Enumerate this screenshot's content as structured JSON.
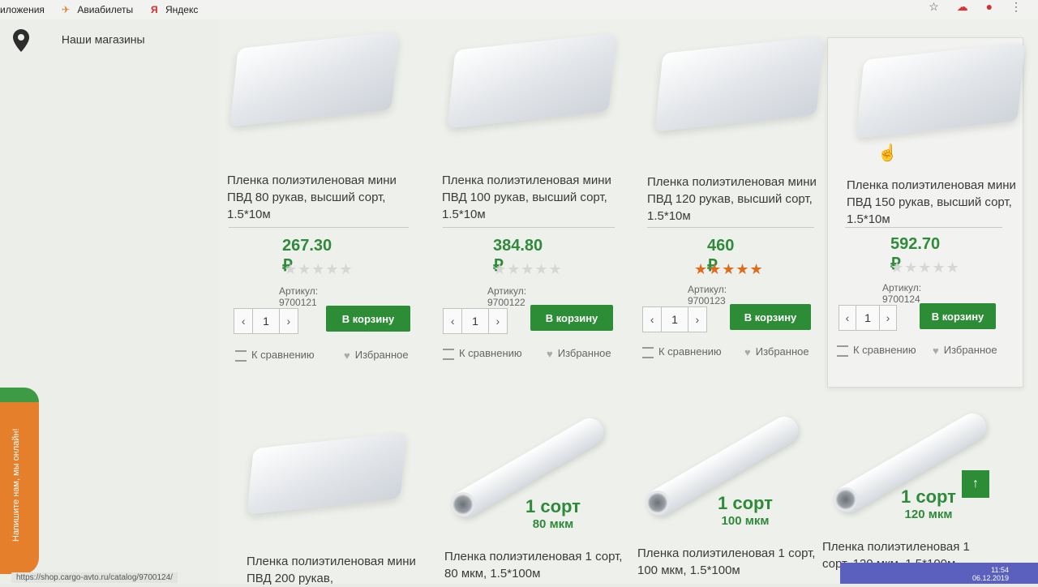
{
  "bookmarks": [
    {
      "label": "иложения",
      "icon": "apps-icon"
    },
    {
      "label": "Авиабилеты",
      "icon": "plane-icon"
    },
    {
      "label": "Яндекс",
      "icon": "yandex-icon"
    }
  ],
  "sidebar": {
    "stores_label": "Наши магазины"
  },
  "actions": {
    "cart_label": "В корзину",
    "compare_label": "К сравнению",
    "favorite_label": "Избранное"
  },
  "products": [
    {
      "title": "Пленка полиэтиленовая мини ПВД 80 рукав, высший сорт, 1.5*10м",
      "price": "267.30 ₽",
      "rating": 0,
      "sku": "Артикул: 9700121",
      "qty": "1"
    },
    {
      "title": "Пленка полиэтиленовая мини ПВД 100 рукав, высший сорт, 1.5*10м",
      "price": "384.80 ₽",
      "rating": 0,
      "sku": "Артикул: 9700122",
      "qty": "1"
    },
    {
      "title": "Пленка полиэтиленовая мини ПВД 120 рукав, высший сорт, 1.5*10м",
      "price": "460 ₽",
      "rating": 5,
      "sku": "Артикул: 9700123",
      "qty": "1"
    },
    {
      "title": "Пленка полиэтиленовая мини ПВД 150 рукав, высший сорт, 1.5*10м",
      "price": "592.70 ₽",
      "rating": 0,
      "sku": "Артикул: 9700124",
      "qty": "1"
    }
  ],
  "products_row2": [
    {
      "title": "Пленка полиэтиленовая мини ПВД 200 рукав,",
      "badge_grade": "",
      "badge_thickness": ""
    },
    {
      "title": "Пленка полиэтиленовая 1 сорт, 80 мкм, 1.5*100м",
      "badge_grade": "1 сорт",
      "badge_thickness": "80 мкм"
    },
    {
      "title": "Пленка полиэтиленовая 1 сорт, 100 мкм, 1.5*100м",
      "badge_grade": "1 сорт",
      "badge_thickness": "100 мкм"
    },
    {
      "title": "Пленка полиэтиленовая 1 сорт, 120 мкм, 1.5*100м",
      "badge_grade": "1 сорт",
      "badge_thickness": "120 мкм"
    }
  ],
  "chat_widget": {
    "label": "Напишите нам, мы онлайн!"
  },
  "status_bar": {
    "url": "https://shop.cargo-avto.ru/catalog/9700124/"
  },
  "taskbar": {
    "time": "11:54",
    "date": "06.12.2019"
  },
  "colors": {
    "price_green": "#2f8a3a",
    "cart_green": "#2c8d36",
    "star_orange": "#e06b1c",
    "chat_orange": "#e57f2b"
  }
}
